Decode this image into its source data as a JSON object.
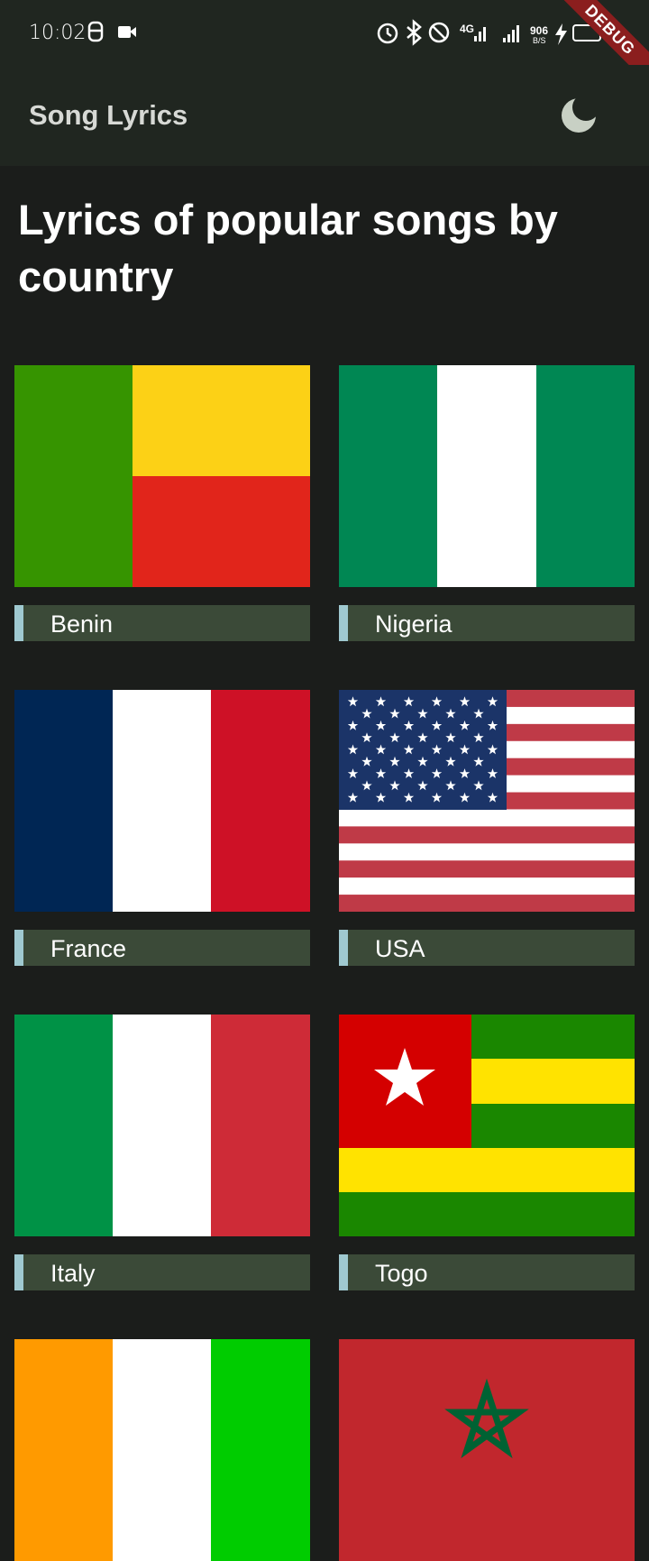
{
  "status_bar": {
    "time": "10:02",
    "network": "4G",
    "speed_value": "906",
    "speed_unit": "B/S",
    "debug_label": "DEBUG",
    "icons_left": [
      "face-icon",
      "video-camera-icon"
    ],
    "icons_right": [
      "alarm-icon",
      "bluetooth-icon",
      "do-not-disturb-icon",
      "signal-icon",
      "signal-icon",
      "charging-icon",
      "battery-icon"
    ]
  },
  "app_bar": {
    "title": "Song Lyrics",
    "theme_icon": "moon-icon"
  },
  "main": {
    "heading": "Lyrics of popular songs by country",
    "countries": [
      {
        "name": "Benin",
        "flag": "benin"
      },
      {
        "name": "Nigeria",
        "flag": "nigeria"
      },
      {
        "name": "France",
        "flag": "france"
      },
      {
        "name": "USA",
        "flag": "usa"
      },
      {
        "name": "Italy",
        "flag": "italy"
      },
      {
        "name": "Togo",
        "flag": "togo"
      },
      {
        "name": "",
        "flag": "cote-divoire"
      },
      {
        "name": "",
        "flag": "morocco"
      }
    ]
  },
  "colors": {
    "background": "#1b1d1b",
    "app_bar": "#202620",
    "label_bar": "#3b4a38",
    "label_accent": "#9fc9d0"
  }
}
